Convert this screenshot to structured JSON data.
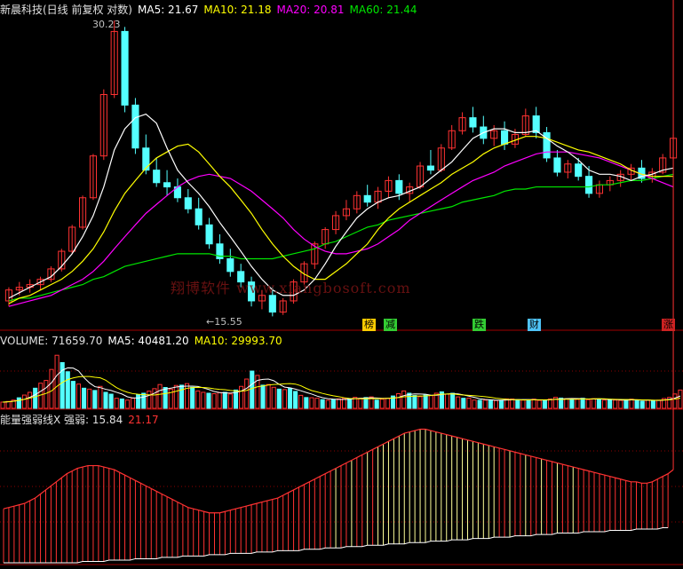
{
  "header": {
    "title": "新晨科技(日线 前复权 对数)",
    "ma5": "MA5: 21.67",
    "ma10": "MA10: 21.18",
    "ma20": "MA20: 20.81",
    "ma60": "MA60: 21.44"
  },
  "volume_header": {
    "label": "VOLUME: 71659.70",
    "ma5": "MA5: 40481.20",
    "ma10": "MA10: 29993.70"
  },
  "indicator_header": {
    "label": "能量强弱线X 强弱: 15.84",
    "value2": "21.17"
  },
  "annotations": {
    "high": "30.23",
    "low": "←15.55"
  },
  "event_tags": [
    {
      "text": "榜",
      "color": "#ffcc00"
    },
    {
      "text": "减",
      "color": "#33cc33"
    },
    {
      "text": "跌",
      "color": "#33cc33"
    },
    {
      "text": "财",
      "color": "#4fc3f7"
    },
    {
      "text": "涨",
      "color": "#cc2222"
    }
  ],
  "watermark": "翔博软件 www.xiangbosoft.com",
  "colors": {
    "up": "#ff3232",
    "down": "#54ffff",
    "ma5": "#ffffff",
    "ma10": "#ffff00",
    "ma20": "#ff00ff",
    "ma60": "#00e600",
    "grid": "#8b0000"
  },
  "chart_data": {
    "type": "candlestick",
    "scale": "log",
    "ylim": [
      15.5,
      30.3
    ],
    "ohlc": [
      [
        16.1,
        16.6,
        15.9,
        16.5
      ],
      [
        16.5,
        16.8,
        16.3,
        16.6
      ],
      [
        16.6,
        16.9,
        16.4,
        16.7
      ],
      [
        16.7,
        17.0,
        16.5,
        16.9
      ],
      [
        16.9,
        17.4,
        16.8,
        17.3
      ],
      [
        17.3,
        18.1,
        17.2,
        18.0
      ],
      [
        18.0,
        19.1,
        17.9,
        19.0
      ],
      [
        19.0,
        20.4,
        18.9,
        20.3
      ],
      [
        20.3,
        22.4,
        20.2,
        22.3
      ],
      [
        22.3,
        25.9,
        22.1,
        25.6
      ],
      [
        25.6,
        30.23,
        25.4,
        29.5
      ],
      [
        29.5,
        29.8,
        24.6,
        25.0
      ],
      [
        25.0,
        25.4,
        22.4,
        22.7
      ],
      [
        22.7,
        23.4,
        21.4,
        21.6
      ],
      [
        21.6,
        22.2,
        20.8,
        21.0
      ],
      [
        21.0,
        21.6,
        20.4,
        20.8
      ],
      [
        20.8,
        21.2,
        20.1,
        20.3
      ],
      [
        20.3,
        20.7,
        19.6,
        19.8
      ],
      [
        19.8,
        20.3,
        18.9,
        19.1
      ],
      [
        19.1,
        19.4,
        18.1,
        18.3
      ],
      [
        18.3,
        18.7,
        17.5,
        17.7
      ],
      [
        17.7,
        18.1,
        17.0,
        17.2
      ],
      [
        17.2,
        17.5,
        16.6,
        16.8
      ],
      [
        16.8,
        17.0,
        15.9,
        16.1
      ],
      [
        16.1,
        16.5,
        15.8,
        16.3
      ],
      [
        16.3,
        16.6,
        15.55,
        15.7
      ],
      [
        15.7,
        16.2,
        15.6,
        16.1
      ],
      [
        16.1,
        16.9,
        16.0,
        16.8
      ],
      [
        16.8,
        17.6,
        16.7,
        17.5
      ],
      [
        17.5,
        18.4,
        17.3,
        18.3
      ],
      [
        18.3,
        19.0,
        18.1,
        18.9
      ],
      [
        18.9,
        19.7,
        18.7,
        19.5
      ],
      [
        19.5,
        20.2,
        19.3,
        19.8
      ],
      [
        19.8,
        20.6,
        19.6,
        20.4
      ],
      [
        20.4,
        20.9,
        19.9,
        20.1
      ],
      [
        20.1,
        20.8,
        19.8,
        20.6
      ],
      [
        20.6,
        21.3,
        20.3,
        21.1
      ],
      [
        21.1,
        21.4,
        20.2,
        20.5
      ],
      [
        20.5,
        21.0,
        20.1,
        20.8
      ],
      [
        20.8,
        22.0,
        20.7,
        21.8
      ],
      [
        21.8,
        22.6,
        21.4,
        21.6
      ],
      [
        21.6,
        22.9,
        21.5,
        22.7
      ],
      [
        22.7,
        23.9,
        22.6,
        23.6
      ],
      [
        23.6,
        24.6,
        23.4,
        24.3
      ],
      [
        24.3,
        24.9,
        23.5,
        23.8
      ],
      [
        23.8,
        24.4,
        22.9,
        23.2
      ],
      [
        23.2,
        23.9,
        22.8,
        23.6
      ],
      [
        23.6,
        24.1,
        22.6,
        22.9
      ],
      [
        22.9,
        23.7,
        22.7,
        23.4
      ],
      [
        23.4,
        24.8,
        23.3,
        24.4
      ],
      [
        24.4,
        24.9,
        23.2,
        23.5
      ],
      [
        23.5,
        23.8,
        22.0,
        22.2
      ],
      [
        22.2,
        22.6,
        21.3,
        21.5
      ],
      [
        21.5,
        22.1,
        21.2,
        21.9
      ],
      [
        21.9,
        22.2,
        21.1,
        21.3
      ],
      [
        21.3,
        21.8,
        20.3,
        20.5
      ],
      [
        20.5,
        21.1,
        20.3,
        20.9
      ],
      [
        20.9,
        21.3,
        20.6,
        21.1
      ],
      [
        21.1,
        21.6,
        20.8,
        21.4
      ],
      [
        21.4,
        21.9,
        21.1,
        21.7
      ],
      [
        21.7,
        22.1,
        21.0,
        21.2
      ],
      [
        21.2,
        21.7,
        21.0,
        21.5
      ],
      [
        21.5,
        22.4,
        21.4,
        22.2
      ],
      [
        22.2,
        23.4,
        22.1,
        23.2
      ]
    ],
    "ma5": [
      16.2,
      16.4,
      16.6,
      16.8,
      17.0,
      17.4,
      17.9,
      18.6,
      19.5,
      20.8,
      22.6,
      23.7,
      24.3,
      24.5,
      24.0,
      22.7,
      21.6,
      21.0,
      20.5,
      19.9,
      19.2,
      18.6,
      18.0,
      17.4,
      16.9,
      16.5,
      16.3,
      16.3,
      16.5,
      16.9,
      17.5,
      18.2,
      18.8,
      19.4,
      19.8,
      20.1,
      20.3,
      20.4,
      20.6,
      20.8,
      21.2,
      21.6,
      22.0,
      22.6,
      23.2,
      23.5,
      23.7,
      23.7,
      23.5,
      23.5,
      23.6,
      23.2,
      22.8,
      22.5,
      22.1,
      21.6,
      21.4,
      21.4,
      21.3,
      21.1,
      21.3,
      21.4,
      21.6,
      21.7
    ],
    "ma10": [
      16.0,
      16.2,
      16.3,
      16.5,
      16.7,
      16.9,
      17.2,
      17.6,
      18.1,
      18.8,
      19.7,
      20.5,
      21.1,
      21.7,
      22.2,
      22.5,
      22.8,
      22.9,
      22.5,
      21.9,
      21.3,
      20.8,
      20.2,
      19.6,
      18.9,
      18.3,
      17.8,
      17.4,
      17.1,
      16.9,
      16.9,
      17.2,
      17.5,
      17.9,
      18.3,
      18.9,
      19.4,
      19.8,
      20.1,
      20.4,
      20.7,
      21.0,
      21.4,
      21.7,
      22.0,
      22.4,
      22.7,
      22.9,
      23.1,
      23.3,
      23.3,
      23.2,
      23.0,
      22.8,
      22.6,
      22.5,
      22.3,
      22.1,
      21.9,
      21.6,
      21.4,
      21.3,
      21.3,
      21.3
    ],
    "ma20": [
      15.9,
      16.0,
      16.1,
      16.2,
      16.3,
      16.5,
      16.7,
      16.9,
      17.2,
      17.6,
      18.1,
      18.6,
      19.1,
      19.6,
      20.0,
      20.4,
      20.8,
      21.1,
      21.3,
      21.4,
      21.3,
      21.2,
      20.9,
      20.6,
      20.2,
      19.8,
      19.4,
      18.9,
      18.5,
      18.2,
      18.0,
      17.9,
      17.9,
      18.0,
      18.1,
      18.3,
      18.6,
      18.9,
      19.3,
      19.6,
      19.9,
      20.2,
      20.5,
      20.8,
      21.1,
      21.3,
      21.5,
      21.8,
      22.0,
      22.2,
      22.4,
      22.5,
      22.5,
      22.5,
      22.4,
      22.3,
      22.2,
      22.0,
      21.8,
      21.6,
      21.4,
      21.2,
      21.0,
      20.8
    ],
    "ma60": [
      16.1,
      16.2,
      16.2,
      16.3,
      16.4,
      16.5,
      16.6,
      16.7,
      16.9,
      17.0,
      17.2,
      17.4,
      17.5,
      17.6,
      17.7,
      17.8,
      17.9,
      17.9,
      17.9,
      17.9,
      17.8,
      17.8,
      17.7,
      17.7,
      17.7,
      17.7,
      17.8,
      17.9,
      18.0,
      18.1,
      18.3,
      18.4,
      18.6,
      18.8,
      19.0,
      19.1,
      19.3,
      19.4,
      19.5,
      19.6,
      19.7,
      19.8,
      19.9,
      20.1,
      20.2,
      20.3,
      20.4,
      20.6,
      20.7,
      20.7,
      20.8,
      20.8,
      20.8,
      20.8,
      20.8,
      20.8,
      20.9,
      20.9,
      21.0,
      21.1,
      21.1,
      21.2,
      21.3,
      21.4
    ],
    "volume": [
      6800,
      7500,
      9000,
      11500,
      14500,
      17500,
      22000,
      27500,
      30500,
      42500,
      58000,
      50000,
      40000,
      29500,
      26500,
      22000,
      21000,
      19500,
      24000,
      17500,
      15500,
      11000,
      10200,
      9000,
      11000,
      15000,
      16500,
      18800,
      21500,
      26000,
      22800,
      21000,
      25000,
      25300,
      27000,
      23000,
      19000,
      17500,
      16500,
      16000,
      17200,
      17500,
      15700,
      20000,
      24000,
      32000,
      40700,
      36000,
      25300,
      26000,
      23000,
      21000,
      20500,
      21900,
      18500,
      14200,
      11800,
      11600,
      11000,
      9500,
      8800,
      9200,
      10300,
      10900,
      10500,
      12000,
      11000,
      11800,
      12500,
      9000,
      10000,
      11000,
      13500,
      16000,
      19000,
      16500,
      14000,
      12800,
      14500,
      13900,
      16500,
      18000,
      15500,
      16500,
      12500,
      11000,
      11100,
      9000,
      8800,
      8900,
      9100,
      8500,
      8800,
      10300,
      10200,
      9500,
      9000,
      8800,
      10000,
      8700,
      9000,
      10200,
      12000,
      11200,
      10500,
      10000,
      9800,
      11000,
      9500,
      10500,
      10300,
      9000,
      8900,
      9000,
      8700,
      9500,
      10000,
      8800,
      7700,
      9000,
      8500,
      8900,
      10700,
      12000,
      15700,
      20000
    ],
    "volume_up": [
      true,
      true,
      true,
      false,
      true,
      true,
      false,
      true,
      true,
      true,
      true,
      false,
      false,
      false,
      true,
      false,
      true,
      false,
      true,
      false,
      false,
      true,
      false,
      true,
      true,
      false,
      false,
      true,
      true,
      true,
      false,
      true,
      true,
      false,
      true,
      false,
      true,
      true,
      false,
      true,
      true,
      false,
      true,
      false,
      true,
      true,
      false,
      true,
      false,
      true,
      true,
      false,
      true,
      false,
      false,
      true,
      false,
      true,
      true,
      false,
      true,
      false,
      true,
      true,
      false,
      true,
      true,
      false,
      true,
      false,
      true,
      true,
      false,
      true,
      true,
      false,
      false,
      true,
      false,
      true,
      true,
      false,
      true,
      false,
      true,
      false,
      true,
      true,
      false,
      true,
      false,
      true,
      false,
      true,
      true,
      false,
      true,
      false,
      true,
      true,
      false,
      true,
      true,
      false,
      true,
      false,
      true,
      false,
      true,
      true,
      false,
      true,
      false,
      true,
      true,
      false,
      true,
      false,
      false,
      true,
      false,
      true,
      true,
      true,
      true,
      true
    ],
    "volume_ylim": [
      0,
      65000
    ],
    "indicator": [
      40,
      41,
      42,
      43,
      44,
      46,
      48,
      51,
      54,
      57,
      60,
      63,
      66,
      68,
      70,
      71,
      72,
      72,
      72,
      71,
      70,
      69,
      67,
      65,
      63,
      61,
      59,
      57,
      55,
      53,
      51,
      49,
      47,
      45,
      43,
      41,
      40,
      39,
      38,
      37,
      37,
      37,
      38,
      39,
      40,
      41,
      42,
      43,
      44,
      45,
      46,
      47,
      48,
      50,
      52,
      54,
      56,
      58,
      60,
      62,
      64,
      66,
      68,
      70,
      72,
      74,
      76,
      78,
      80,
      82,
      84,
      86,
      88,
      90,
      92,
      94,
      96,
      97,
      98,
      99,
      99,
      98,
      97,
      96,
      95,
      94,
      93,
      92,
      91,
      90,
      89,
      88,
      87,
      86,
      85,
      84,
      83,
      82,
      81,
      80,
      79,
      78,
      77,
      76,
      75,
      74,
      73,
      72,
      71,
      70,
      69,
      68,
      67,
      66,
      65,
      64,
      63,
      62,
      61,
      60,
      60,
      59,
      59,
      60,
      62,
      64,
      66,
      69
    ],
    "indicator_base": [
      0,
      0,
      0,
      0,
      0,
      0,
      0,
      0,
      0,
      0,
      0,
      0,
      0,
      0,
      0,
      1,
      1,
      1,
      1,
      1,
      2,
      2,
      2,
      2,
      2,
      3,
      3,
      3,
      3,
      3,
      4,
      4,
      4,
      4,
      5,
      5,
      5,
      5,
      5,
      6,
      6,
      6,
      6,
      7,
      7,
      7,
      7,
      7,
      8,
      8,
      8,
      8,
      9,
      9,
      9,
      9,
      9,
      10,
      10,
      10,
      10,
      11,
      11,
      11,
      11,
      12,
      12,
      12,
      12,
      13,
      13,
      13,
      13,
      14,
      14,
      14,
      14,
      15,
      15,
      15,
      15,
      16,
      16,
      16,
      16,
      17,
      17,
      17,
      17,
      18,
      18,
      18,
      18,
      19,
      19,
      19,
      19,
      20,
      20,
      20,
      20,
      21,
      21,
      21,
      21,
      22,
      22,
      22,
      22,
      22,
      23,
      23,
      23,
      23,
      23,
      24,
      24,
      24,
      24,
      24,
      25,
      25,
      25,
      25,
      25,
      26,
      26
    ],
    "indicator_ylim": [
      0,
      100
    ]
  }
}
